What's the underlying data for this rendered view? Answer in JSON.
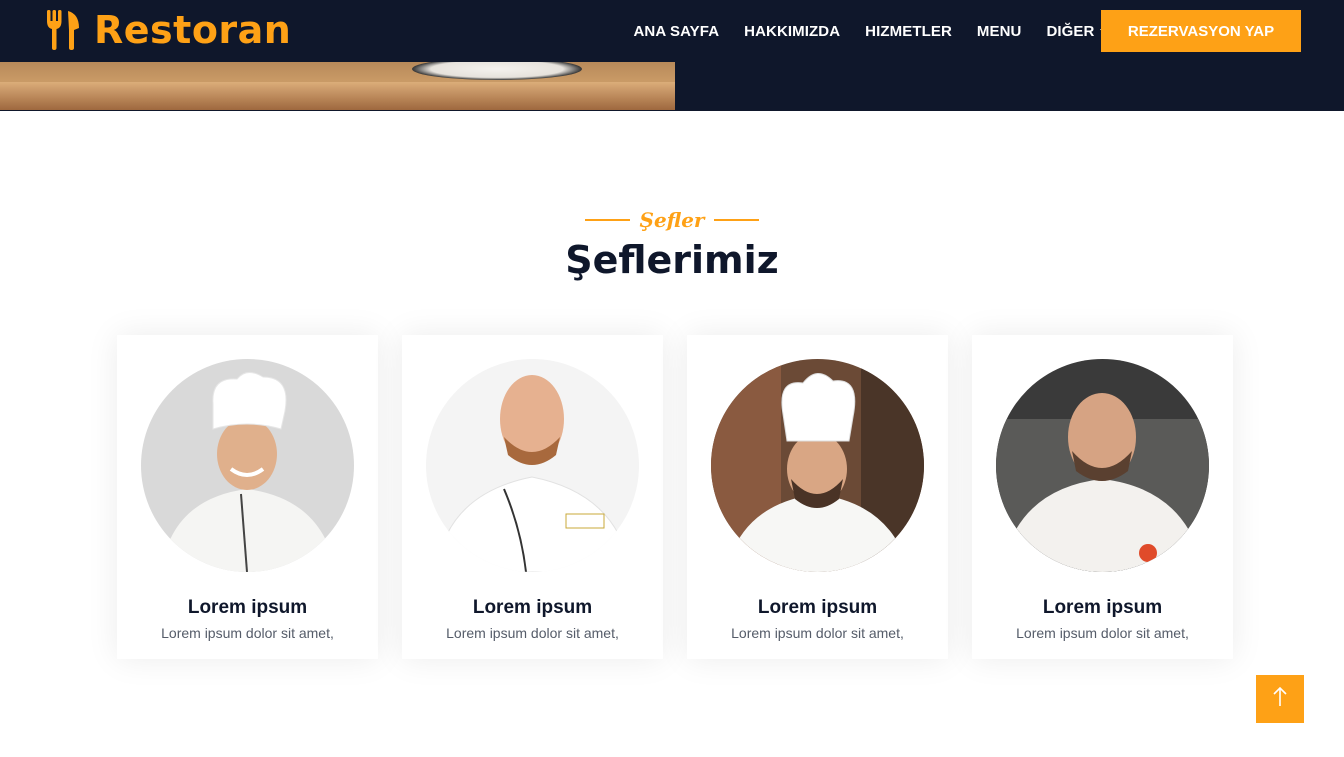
{
  "brand": {
    "name": "Restoran",
    "icon": "utensils-icon",
    "color": "#fea116"
  },
  "nav": {
    "links": [
      "ANA SAYFA",
      "HAKKIMIZDA",
      "HIZMETLER",
      "MENU"
    ],
    "dropdown_label": "DIĞER",
    "cta_label": "REZERVASYON YAP"
  },
  "section": {
    "subtitle": "Şefler",
    "title": "Şeflerimiz"
  },
  "team": [
    {
      "name": "Lorem ipsum",
      "desc": "Lorem ipsum dolor sit amet,"
    },
    {
      "name": "Lorem ipsum",
      "desc": "Lorem ipsum dolor sit amet,"
    },
    {
      "name": "Lorem ipsum",
      "desc": "Lorem ipsum dolor sit amet,"
    },
    {
      "name": "Lorem ipsum",
      "desc": "Lorem ipsum dolor sit amet,"
    }
  ],
  "back_to_top": {
    "icon": "arrow-up-icon"
  },
  "colors": {
    "accent": "#fea116",
    "dark": "#0f172b",
    "text_muted": "#555c69"
  }
}
